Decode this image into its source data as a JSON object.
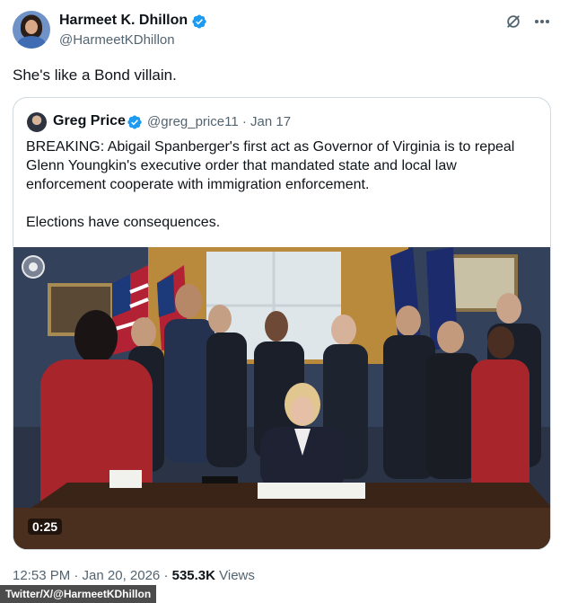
{
  "author": {
    "name": "Harmeet K. Dhillon",
    "handle": "@HarmeetKDhillon"
  },
  "tweet": {
    "text": "She's like a Bond villain."
  },
  "quote": {
    "name": "Greg Price",
    "meta": "@greg_price11 · Jan 17",
    "paragraph1": "BREAKING: Abigail Spanberger's first act as Governor of Virginia is to repeal Glenn Youngkin's executive order that mandated state and local law enforcement cooperate with immigration enforcement.",
    "paragraph2": "Elections have consequences.",
    "video_time": "0:25"
  },
  "footer": {
    "timestamp": "12:53 PM · Jan 20, 2026 · ",
    "views_count": "535.3K",
    "views_label": " Views"
  },
  "credit": "Twitter/X/@HarmeetKDhillon",
  "colors": {
    "verified": "#1d9bf0",
    "text": "#0f1419",
    "secondary": "#536471",
    "border": "#cfd9de"
  },
  "icons": [
    "verified-badge-icon",
    "grok-icon",
    "more-icon",
    "pip-icon"
  ]
}
